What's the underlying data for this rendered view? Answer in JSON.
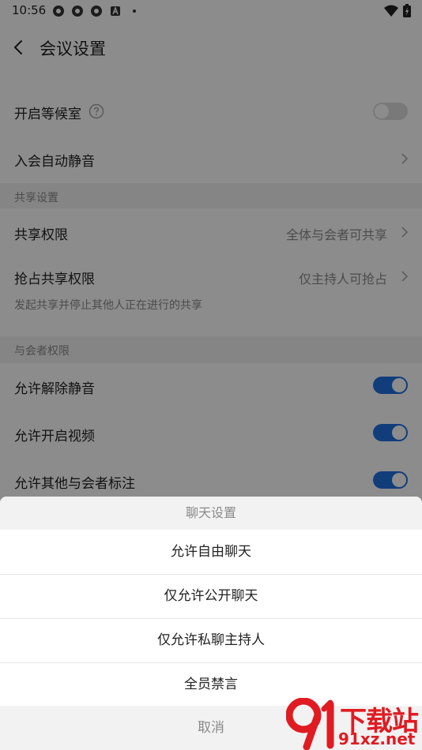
{
  "status": {
    "time": "10:56"
  },
  "header": {
    "title": "会议设置"
  },
  "settings": {
    "waiting_room": {
      "label": "开启等候室",
      "enabled": false
    },
    "auto_mute": {
      "label": "入会自动静音"
    },
    "share_section": {
      "title": "共享设置"
    },
    "share_permission": {
      "label": "共享权限",
      "value": "全体与会者可共享"
    },
    "preempt_share": {
      "label": "抢占共享权限",
      "value": "仅主持人可抢占",
      "hint": "发起共享并停止其他人正在进行的共享"
    },
    "participant_section": {
      "title": "与会者权限"
    },
    "allow_unmute": {
      "label": "允许解除静音",
      "enabled": true
    },
    "allow_video": {
      "label": "允许开启视频",
      "enabled": true
    },
    "allow_annotate": {
      "label": "允许其他与会者标注",
      "enabled": true
    }
  },
  "sheet": {
    "title": "聊天设置",
    "options": [
      "允许自由聊天",
      "仅允许公开聊天",
      "仅允许私聊主持人",
      "全员禁言"
    ],
    "cancel": "取消"
  },
  "watermark": {
    "text": "下载站",
    "url": "91xz.net"
  },
  "colors": {
    "accent": "#1f6fe0",
    "watermark": "#e01b22"
  }
}
